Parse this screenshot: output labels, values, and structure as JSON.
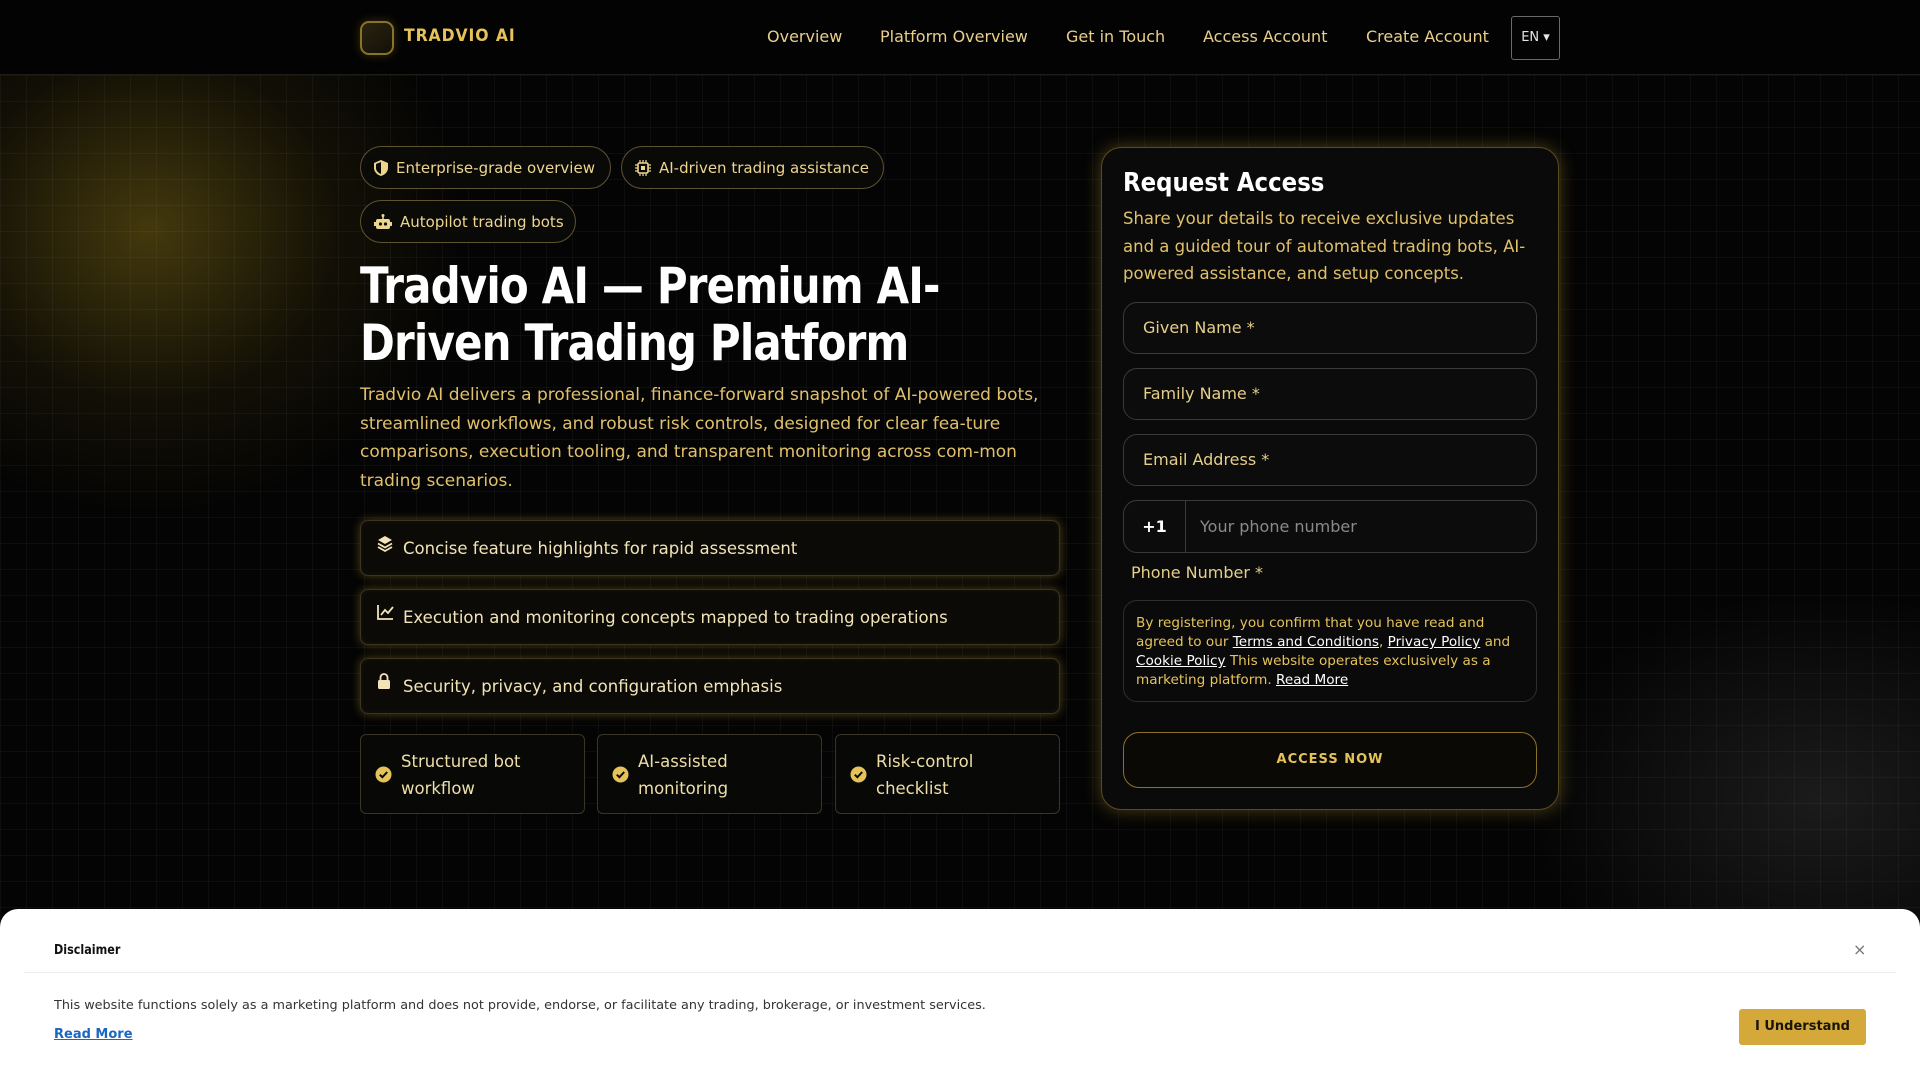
{
  "header": {
    "brand": "TRADVIO AI",
    "nav": [
      "Overview",
      "Platform Overview",
      "Get in Touch",
      "Access Account",
      "Create Account"
    ],
    "language": "EN ▾"
  },
  "hero": {
    "badges": [
      "Enterprise-grade overview",
      "AI-driven trading assistance",
      "Autopilot trading bots"
    ],
    "title": "Tradvio AI — Premium AI-Driven Trading Platform",
    "lead": "Tradvio AI delivers a professional, finance-forward snapshot of AI-powered bots, streamlined workflows, and robust risk controls, designed for clear fea-ture comparisons, execution tooling, and transparent monitoring across com-mon trading scenarios.",
    "features": [
      "Concise feature highlights for rapid assessment",
      "Execution and monitoring concepts mapped to trading operations",
      "Security, privacy, and configuration emphasis"
    ],
    "highlights": [
      "Structured bot workflow",
      "AI-assisted monitoring",
      "Risk-control checklist"
    ]
  },
  "form": {
    "title": "Request Access",
    "subtitle": "Share your details to receive exclusive updates and a guided tour of automated trading bots, AI-powered assistance, and setup concepts.",
    "given_name": "Given Name *",
    "family_name": "Family Name *",
    "email": "Email Address *",
    "phone_code": "+1",
    "phone_placeholder": "Your phone number",
    "phone_label": "Phone Number *",
    "consent": {
      "prefix": "By registering, you confirm that you have read and agreed to our ",
      "terms": "Terms and Conditions",
      "sep": ", ",
      "privacy": "Privacy Policy",
      "and": " and ",
      "cookie": "Cookie Policy",
      "middle": " This website operates exclusively as a marketing platform. ",
      "read_more": "Read More"
    },
    "submit": "ACCESS NOW"
  },
  "disclaimer": {
    "title": "Disclaimer",
    "close": "×",
    "text": "This website functions solely as a marketing platform and does not provide, endorse, or facilitate any trading, brokerage, or investment services.",
    "read_more": "Read More",
    "accept": "I Understand"
  },
  "colors": {
    "accent": "#e6c35a",
    "background": "#050505",
    "button": "#d4a93a"
  },
  "icons": {
    "badges": [
      "shield-icon",
      "chip-icon",
      "robot-icon"
    ],
    "features": [
      "layers-icon",
      "chart-icon",
      "lock-icon"
    ],
    "highlights": [
      "check-circle-icon",
      "check-circle-icon",
      "check-circle-icon"
    ]
  }
}
